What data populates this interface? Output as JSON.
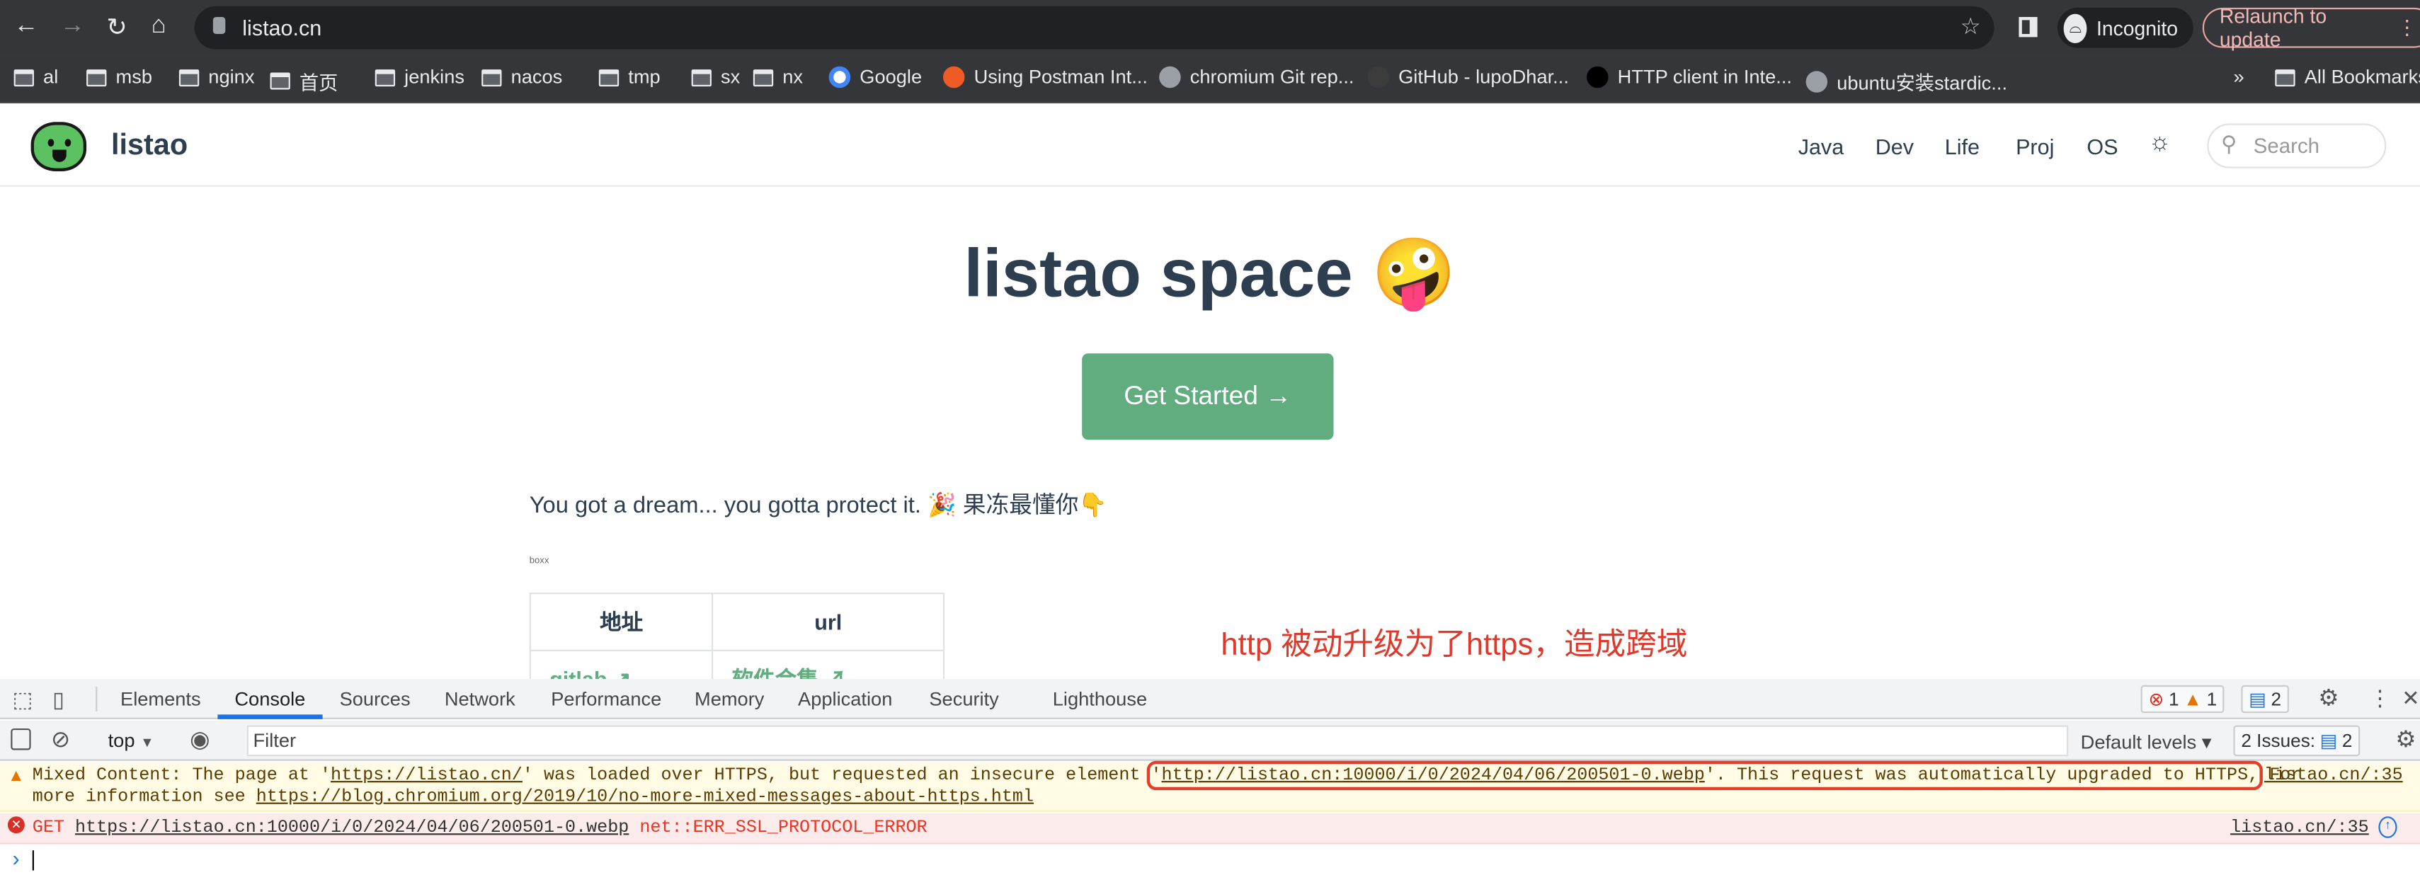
{
  "browser": {
    "url": "listao.cn",
    "incognito_label": "Incognito",
    "relaunch_label": "Relaunch to update",
    "bookmarks": [
      {
        "label": "al",
        "icon": "folder-icon"
      },
      {
        "label": "msb",
        "icon": "folder-icon"
      },
      {
        "label": "nginx",
        "icon": "folder-icon"
      },
      {
        "label": "首页",
        "icon": "folder-icon"
      },
      {
        "label": "jenkins",
        "icon": "folder-icon"
      },
      {
        "label": "nacos",
        "icon": "folder-icon"
      },
      {
        "label": "tmp",
        "icon": "folder-icon"
      },
      {
        "label": "sx",
        "icon": "folder-icon"
      },
      {
        "label": "nx",
        "icon": "folder-icon"
      },
      {
        "label": "Google",
        "icon": "google-icon"
      },
      {
        "label": "Using Postman Int...",
        "icon": "postman-icon"
      },
      {
        "label": "chromium Git rep...",
        "icon": "globe-icon"
      },
      {
        "label": "GitHub - lupoDhar...",
        "icon": "github-icon"
      },
      {
        "label": "HTTP client in Inte...",
        "icon": "jetbrains-icon"
      },
      {
        "label": "ubuntu安装stardic...",
        "icon": "globe-icon"
      }
    ],
    "overflow_label": "»",
    "all_bookmarks_label": "All Bookmarks"
  },
  "site": {
    "logo_text": "listao",
    "nav": [
      "Java",
      "Dev",
      "Life",
      "Proj",
      "OS"
    ],
    "search_placeholder": "Search",
    "hero_title": "listao space 🤪",
    "cta_label": "Get Started →",
    "tagline": "You got a dream... you gotta protect it. 🎉 果冻最懂你👇",
    "broken_image_alt": "boxx",
    "table": {
      "headers": [
        "地址",
        "url"
      ],
      "rows": [
        [
          "gitlab ↗",
          "软件合集 ↗"
        ]
      ]
    },
    "annotation": "http 被动升级为了https，造成跨域"
  },
  "devtools": {
    "tabs": [
      "Elements",
      "Console",
      "Sources",
      "Network",
      "Performance",
      "Memory",
      "Application",
      "Security",
      "Lighthouse"
    ],
    "active_tab": "Console",
    "counts": {
      "errors": "1",
      "warnings": "1",
      "info": "2"
    },
    "context": "top",
    "filter_placeholder": "Filter",
    "levels_label": "Default levels ▾",
    "issues_label": "2 Issues:",
    "issues_count": "2",
    "messages": {
      "warning": {
        "p1": "Mixed Content: The page at '",
        "link1": "https://listao.cn/",
        "p2": "' was loaded over HTTPS, but requested an insecure element ",
        "boxed_pre": "'",
        "link2": "http://listao.cn:10000/i/0/2024/04/06/200501-0.webp",
        "boxed_post": "'. This request was automatically upgraded to HTTPS,",
        "p3": " For",
        "line2_pre": "more information see ",
        "link3": "https://blog.chromium.org/2019/10/no-more-mixed-messages-about-https.html",
        "source": "listao.cn/:35"
      },
      "error": {
        "method": "GET",
        "url": "https://listao.cn:10000/i/0/2024/04/06/200501-0.webp",
        "error": "net::ERR_SSL_PROTOCOL_ERROR",
        "source": "listao.cn/:35"
      }
    },
    "prompt": "›"
  },
  "colors": {
    "accent": "#62ad80",
    "annotation": "#e0382a",
    "devtools_blue": "#1a73e8"
  }
}
